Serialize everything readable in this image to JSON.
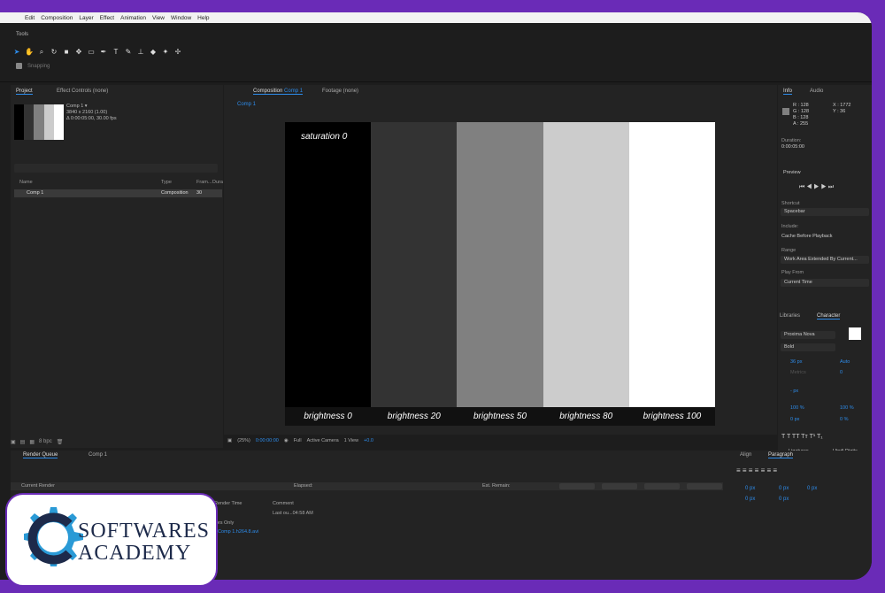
{
  "menu": [
    "Edit",
    "Composition",
    "Layer",
    "Effect",
    "Animation",
    "View",
    "Window",
    "Help"
  ],
  "tools": {
    "title": "Tools",
    "snapping_label": "Snapping"
  },
  "project": {
    "tab_project": "Project",
    "tab_effect_controls": "Effect Controls (none)",
    "comp_name": "Comp 1 ▾",
    "comp_dims": "3840 x 2160 (1.00)",
    "comp_duration": "Δ 0:00:05:00, 30.00 fps",
    "columns": {
      "name": "Name",
      "type": "Type",
      "frame": "Fram...",
      "dur": "Dura"
    },
    "items": [
      {
        "name": "Comp 1",
        "type": "Composition",
        "frame": "30"
      }
    ],
    "footer_bpc": "8 bpc"
  },
  "composition": {
    "tab_label": "Composition",
    "tab_comp": "Comp 1",
    "tab_footage": "Footage (none)",
    "sub_tab": "Comp 1",
    "saturation_label": "saturation 0",
    "bars": [
      {
        "label": "brightness 0",
        "color": "#000000"
      },
      {
        "label": "brightness 20",
        "color": "#333333"
      },
      {
        "label": "brightness 50",
        "color": "#808080"
      },
      {
        "label": "brightness 80",
        "color": "#cccccc"
      },
      {
        "label": "brightness 100",
        "color": "#ffffff"
      }
    ],
    "footer": {
      "zoom": "(25%)",
      "timecode": "0:00:00:00",
      "resolution": "Full",
      "camera": "Active Camera",
      "view": "1 View",
      "exposure": "+0.0"
    }
  },
  "info": {
    "tab_info": "Info",
    "tab_audio": "Audio",
    "r": "R : 128",
    "g": "G : 128",
    "b": "B : 128",
    "a": "A : 255",
    "x": "X : 1772",
    "y": "Y : 36",
    "swatch_color": "#808080",
    "duration_label": "Duration:",
    "duration_value": "0:00:05:00"
  },
  "preview": {
    "title": "Preview",
    "shortcut_label": "Shortcut",
    "shortcut_value": "Spacebar",
    "include_label": "Include:",
    "cache_label": "Cache Before Playback",
    "range_label": "Range",
    "range_value": "Work Area Extended By Current...",
    "play_from_label": "Play From",
    "play_from_value": "Current Time"
  },
  "character": {
    "tab_libraries": "Libraries",
    "tab_character": "Character",
    "font": "Proxima Nova",
    "style": "Bold",
    "size": "36 px",
    "leading": "Auto",
    "kerning": "Metrics",
    "tracking": "0",
    "stroke": "- px",
    "vscale": "100 %",
    "hscale": "100 %",
    "baseline": "0 px",
    "tsume": "0 %",
    "ligatures": "Ligatures",
    "hindi": "Hindi Digits"
  },
  "render_queue": {
    "tab": "Render Queue",
    "tab_comp": "Comp 1",
    "current_render": "Current Render",
    "elapsed": "Elapsed:",
    "remain": "Est. Remain:",
    "render_time": "Render Time",
    "comment": "Comment",
    "log": "Last ou...04:58 AM",
    "errors": "rors Only",
    "output": "Comp 1.h264.8.avi"
  },
  "paragraph": {
    "tab_align": "Align",
    "tab_paragraph": "Paragraph",
    "indent1": "0 px",
    "indent2": "0 px",
    "indent3": "0 px",
    "indent4": "0 px",
    "indent5": "0 px"
  },
  "logo": {
    "line1": "SOFTWARES",
    "line2": "ACADEMY"
  }
}
